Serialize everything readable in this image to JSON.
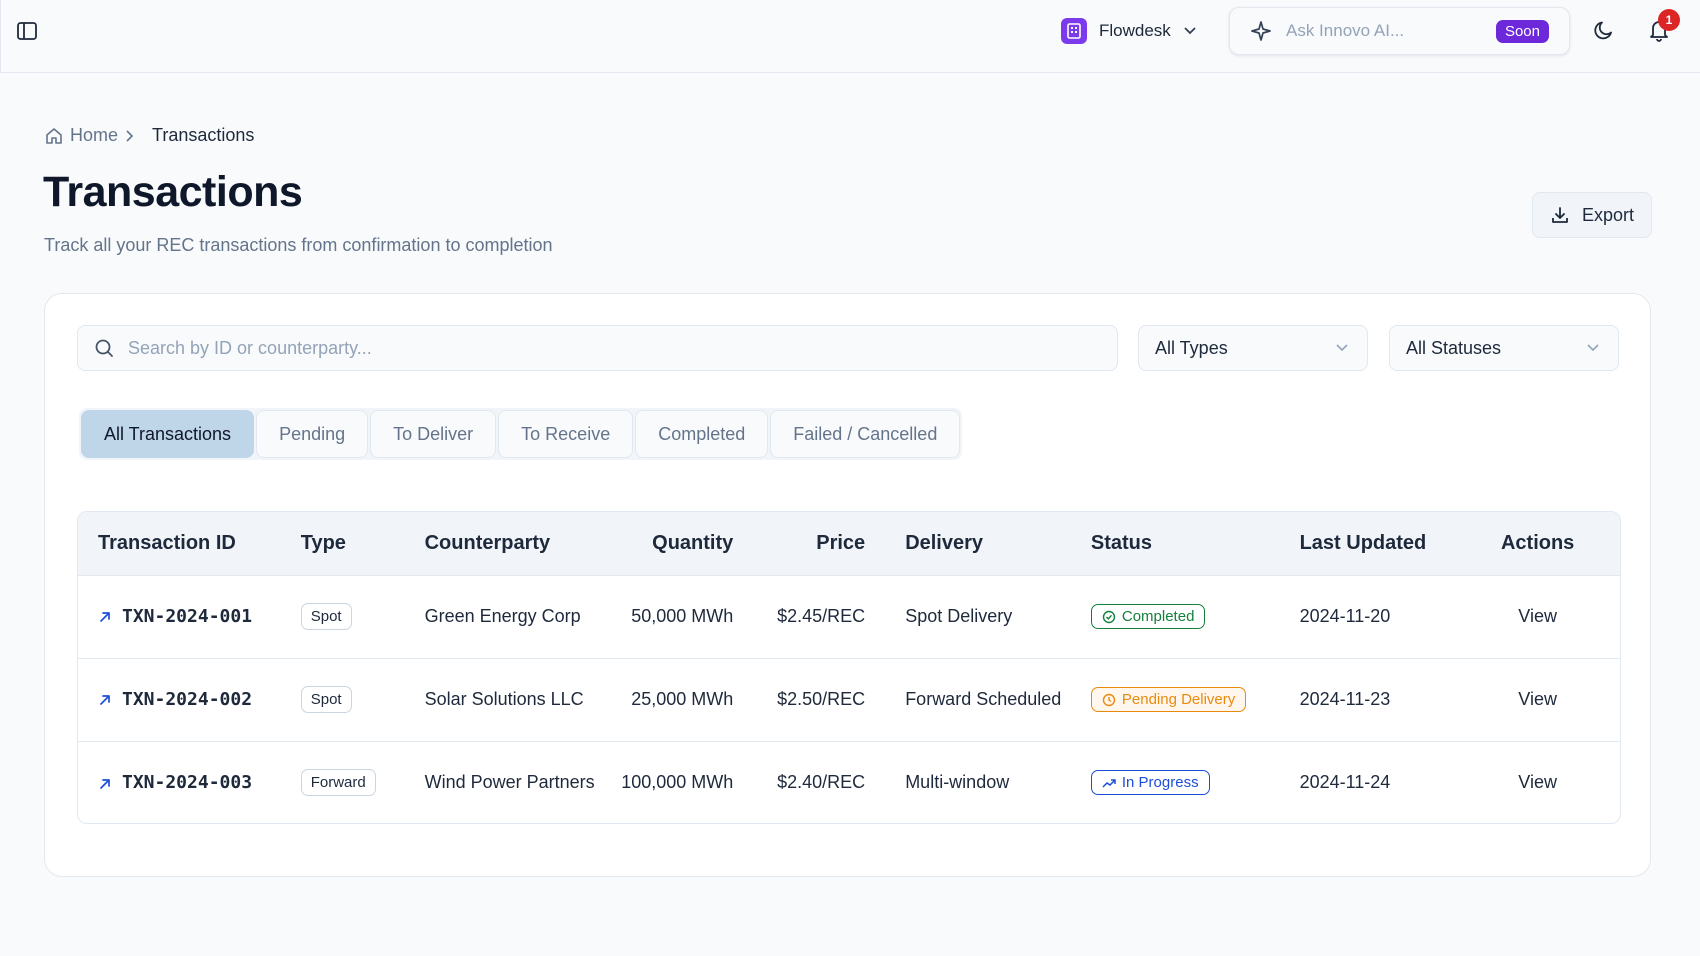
{
  "header": {
    "org_name": "Flowdesk",
    "ai_placeholder": "Ask Innovo AI...",
    "soon_label": "Soon",
    "notification_count": "1"
  },
  "breadcrumb": {
    "home": "Home",
    "current": "Transactions"
  },
  "page": {
    "title": "Transactions",
    "subtitle": "Track all your REC transactions from confirmation to completion",
    "export_label": "Export"
  },
  "filters": {
    "search_placeholder": "Search by ID or counterparty...",
    "type_value": "All Types",
    "status_value": "All Statuses"
  },
  "tabs": [
    "All Transactions",
    "Pending",
    "To Deliver",
    "To Receive",
    "Completed",
    "Failed / Cancelled"
  ],
  "table": {
    "columns": [
      "Transaction ID",
      "Type",
      "Counterparty",
      "Quantity",
      "Price",
      "Delivery",
      "Status",
      "Last Updated",
      "Actions"
    ],
    "rows": [
      {
        "id": "TXN-2024-001",
        "type": "Spot",
        "counterparty": "Green Energy Corp",
        "quantity": "50,000 MWh",
        "price": "$2.45/REC",
        "delivery": "Spot Delivery",
        "status": "Completed",
        "updated": "2024-11-20",
        "action": "View"
      },
      {
        "id": "TXN-2024-002",
        "type": "Spot",
        "counterparty": "Solar Solutions LLC",
        "quantity": "25,000 MWh",
        "price": "$2.50/REC",
        "delivery": "Forward Scheduled",
        "status": "Pending Delivery",
        "updated": "2024-11-23",
        "action": "View"
      },
      {
        "id": "TXN-2024-003",
        "type": "Forward",
        "counterparty": "Wind Power Partners",
        "quantity": "100,000 MWh",
        "price": "$2.40/REC",
        "delivery": "Multi-window",
        "status": "In Progress",
        "updated": "2024-11-24",
        "action": "View"
      }
    ]
  },
  "colors": {
    "accent": "#7c3aed",
    "tab_active": "#bfd5e8",
    "status_completed": "#15803d",
    "status_pending": "#ea8a0c",
    "status_progress": "#1d4ed8",
    "badge_red": "#dc2626"
  },
  "icons": [
    "sidebar-toggle-icon",
    "building-icon",
    "chevron-down-icon",
    "sparkle-icon",
    "moon-icon",
    "bell-icon",
    "home-icon",
    "chevron-right-icon",
    "download-icon",
    "search-icon",
    "arrow-up-right-icon",
    "check-circle-icon",
    "clock-icon",
    "trending-up-icon"
  ]
}
